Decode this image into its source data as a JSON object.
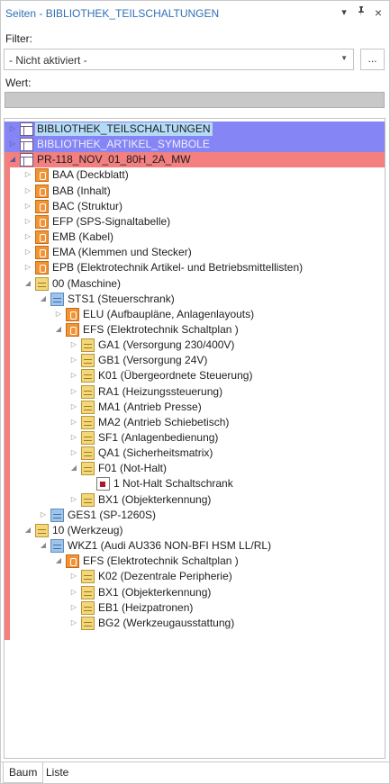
{
  "panel": {
    "title": "Seiten - BIBLIOTHEK_TEILSCHALTUNGEN",
    "buttons": {
      "dropdown": "▾",
      "pin": "📌",
      "close": "×"
    }
  },
  "filter": {
    "label": "Filter:",
    "selected": "- Nicht aktiviert -",
    "more_button": "..."
  },
  "wert": {
    "label": "Wert:"
  },
  "tree": [
    {
      "label": "BIBLIOTHEK_TEILSCHALTUNGEN",
      "depth": 0,
      "icon": "project-icon",
      "expander": "collapsed",
      "highlight": "blue",
      "selected": true
    },
    {
      "label": "BIBLIOTHEK_ARTIKEL_SYMBOLE",
      "depth": 0,
      "icon": "project-icon",
      "expander": "collapsed",
      "highlight": "blue"
    },
    {
      "label": "PR-118_NOV_01_80H_2A_MW",
      "depth": 0,
      "icon": "project-icon",
      "expander": "expanded",
      "highlight": "red"
    },
    {
      "label": "BAA (Deckblatt)",
      "depth": 1,
      "icon": "orange",
      "expander": "collapsed"
    },
    {
      "label": "BAB (Inhalt)",
      "depth": 1,
      "icon": "orange",
      "expander": "collapsed"
    },
    {
      "label": "BAC (Struktur)",
      "depth": 1,
      "icon": "orange",
      "expander": "collapsed"
    },
    {
      "label": "EFP (SPS-Signaltabelle)",
      "depth": 1,
      "icon": "orange",
      "expander": "collapsed"
    },
    {
      "label": "EMB (Kabel)",
      "depth": 1,
      "icon": "orange",
      "expander": "collapsed"
    },
    {
      "label": "EMA (Klemmen und Stecker)",
      "depth": 1,
      "icon": "orange",
      "expander": "collapsed"
    },
    {
      "label": "EPB (Elektrotechnik Artikel- und Betriebsmittellisten)",
      "depth": 1,
      "icon": "orange",
      "expander": "collapsed"
    },
    {
      "label": "00 (Maschine)",
      "depth": 1,
      "icon": "yellow",
      "expander": "expanded"
    },
    {
      "label": "STS1 (Steuerschrank)",
      "depth": 2,
      "icon": "blue",
      "expander": "expanded"
    },
    {
      "label": "ELU (Aufbaupläne, Anlagenlayouts)",
      "depth": 3,
      "icon": "orange",
      "expander": "collapsed"
    },
    {
      "label": "EFS (Elektrotechnik Schaltplan )",
      "depth": 3,
      "icon": "orange",
      "expander": "expanded"
    },
    {
      "label": "GA1 (Versorgung 230/400V)",
      "depth": 4,
      "icon": "yellow",
      "expander": "collapsed"
    },
    {
      "label": "GB1 (Versorgung 24V)",
      "depth": 4,
      "icon": "yellow",
      "expander": "collapsed"
    },
    {
      "label": "K01 (Übergeordnete Steuerung)",
      "depth": 4,
      "icon": "yellow",
      "expander": "collapsed"
    },
    {
      "label": "RA1 (Heizungssteuerung)",
      "depth": 4,
      "icon": "yellow",
      "expander": "collapsed"
    },
    {
      "label": "MA1 (Antrieb Presse)",
      "depth": 4,
      "icon": "yellow",
      "expander": "collapsed"
    },
    {
      "label": "MA2 (Antrieb Schiebetisch)",
      "depth": 4,
      "icon": "yellow",
      "expander": "collapsed"
    },
    {
      "label": "SF1 (Anlagenbedienung)",
      "depth": 4,
      "icon": "yellow",
      "expander": "collapsed"
    },
    {
      "label": "QA1 (Sicherheitsmatrix)",
      "depth": 4,
      "icon": "yellow",
      "expander": "collapsed"
    },
    {
      "label": "F01 (Not-Halt)",
      "depth": 4,
      "icon": "yellow",
      "expander": "expanded"
    },
    {
      "label": "1 Not-Halt Schaltschrank",
      "depth": 5,
      "icon": "page",
      "expander": "none"
    },
    {
      "label": "BX1 (Objekterkennung)",
      "depth": 4,
      "icon": "yellow",
      "expander": "collapsed"
    },
    {
      "label": "GES1 (SP-1260S)",
      "depth": 2,
      "icon": "blue",
      "expander": "collapsed"
    },
    {
      "label": "10 (Werkzeug)",
      "depth": 1,
      "icon": "yellow",
      "expander": "expanded"
    },
    {
      "label": "WKZ1 (Audi AU336 NON-BFI HSM LL/RL)",
      "depth": 2,
      "icon": "blue",
      "expander": "expanded"
    },
    {
      "label": "EFS (Elektrotechnik Schaltplan )",
      "depth": 3,
      "icon": "orange",
      "expander": "expanded"
    },
    {
      "label": "K02 (Dezentrale Peripherie)",
      "depth": 4,
      "icon": "yellow",
      "expander": "collapsed"
    },
    {
      "label": "BX1 (Objekterkennung)",
      "depth": 4,
      "icon": "yellow",
      "expander": "collapsed"
    },
    {
      "label": "EB1 (Heizpatronen)",
      "depth": 4,
      "icon": "yellow",
      "expander": "collapsed"
    },
    {
      "label": "BG2 (Werkzeugausstattung)",
      "depth": 4,
      "icon": "yellow",
      "expander": "collapsed"
    }
  ],
  "tabs": [
    {
      "label": "Baum",
      "active": true
    },
    {
      "label": "Liste",
      "active": false
    }
  ],
  "colors": {
    "title": "#2f6fb5",
    "highlight_blue": "#8585f5",
    "highlight_red": "#f47f7f",
    "selection": "#b3dbf5"
  }
}
